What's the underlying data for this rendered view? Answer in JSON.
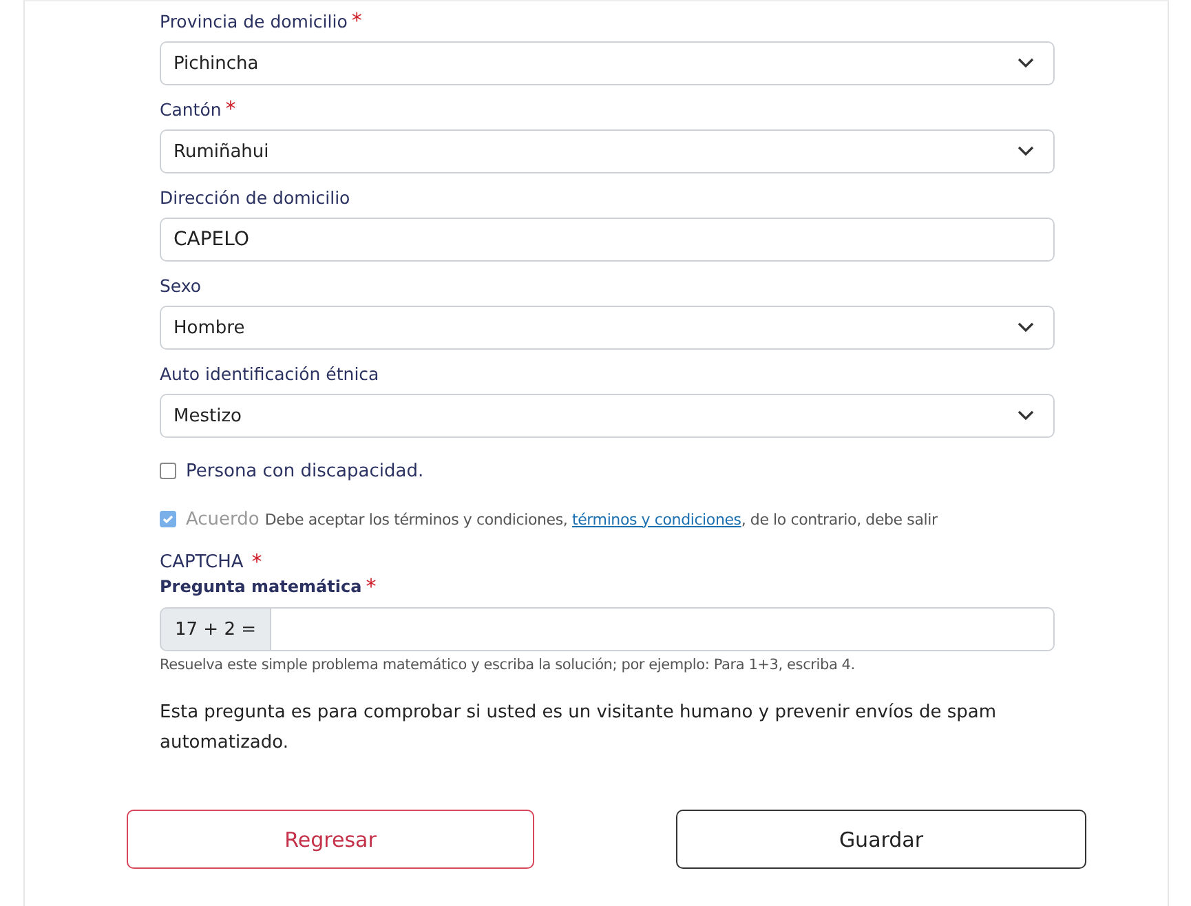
{
  "fields": [
    {
      "kind": "select",
      "label": "Provincia de domicilio",
      "required_mark": "*",
      "value": "Pichincha"
    },
    {
      "kind": "select",
      "label": "Cantón",
      "required_mark": "*",
      "value": "Rumiñahui"
    },
    {
      "kind": "text",
      "label": "Dirección de domicilio",
      "value": "CAPELO"
    },
    {
      "kind": "select",
      "label": "Sexo",
      "value": "Hombre"
    },
    {
      "kind": "select",
      "label": "Auto identificación étnica",
      "value": "Mestizo"
    }
  ],
  "disability": {
    "label": "Persona con discapacidad.",
    "checked": false
  },
  "agreement": {
    "label": "Acuerdo",
    "checked": true,
    "text_before": "Debe aceptar los términos y condiciones,",
    "link": "términos y condiciones",
    "text_after": ", de lo contrario, debe salir"
  },
  "captcha": {
    "title": "CAPTCHA",
    "title_mark": "*",
    "question_label": "Pregunta matemática",
    "question_mark": "*",
    "question": "17 + 2 =",
    "help": "Resuelva este simple problema matemático y escriba la solución; por ejemplo: Para 1+3, escriba 4.",
    "note": "Esta pregunta es para comprobar si usted es un visitante humano y prevenir envíos de spam automatizado."
  },
  "buttons": [
    {
      "label": "Regresar",
      "kind": "secondary"
    },
    {
      "label": "Guardar",
      "kind": "primary"
    }
  ]
}
